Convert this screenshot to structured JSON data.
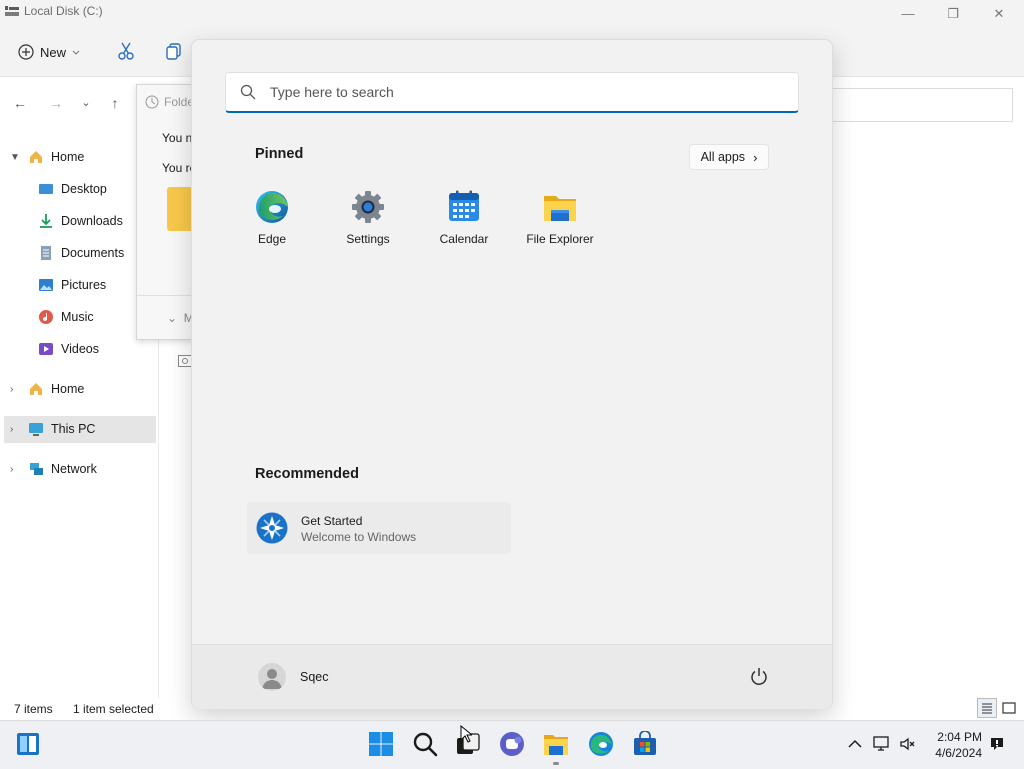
{
  "window": {
    "title": "Local Disk (C:)",
    "minimize_glyph": "—",
    "restore_glyph": "❐",
    "close_glyph": "✕"
  },
  "toolbar": {
    "new_label": "New"
  },
  "sidebar": {
    "items": [
      {
        "label": "Home",
        "icon": "home-icon"
      },
      {
        "label": "Desktop",
        "icon": "desktop-icon"
      },
      {
        "label": "Downloads",
        "icon": "downloads-icon"
      },
      {
        "label": "Documents",
        "icon": "documents-icon"
      },
      {
        "label": "Pictures",
        "icon": "pictures-icon"
      },
      {
        "label": "Music",
        "icon": "music-icon"
      },
      {
        "label": "Videos",
        "icon": "videos-icon"
      },
      {
        "label": "Home",
        "icon": "home-icon"
      },
      {
        "label": "This PC",
        "icon": "this-pc-icon"
      },
      {
        "label": "Network",
        "icon": "network-icon"
      }
    ]
  },
  "dialog": {
    "title": "Folde",
    "line1": "You n",
    "line2": "You re",
    "more": "M"
  },
  "status": {
    "items_count": "7 items",
    "selected": "1 item selected"
  },
  "start_menu": {
    "search_placeholder": "Type here to search",
    "pinned_title": "Pinned",
    "all_apps_label": "All apps",
    "pinned": [
      {
        "label": "Edge",
        "icon": "edge-icon"
      },
      {
        "label": "Settings",
        "icon": "settings-icon"
      },
      {
        "label": "Calendar",
        "icon": "calendar-icon"
      },
      {
        "label": "File Explorer",
        "icon": "file-explorer-icon"
      }
    ],
    "recommended_title": "Recommended",
    "recommended": [
      {
        "title": "Get Started",
        "subtitle": "Welcome to Windows",
        "icon": "get-started-icon"
      }
    ],
    "user_name": "Sqec"
  },
  "taskbar": {
    "apps": [
      "widgets-icon",
      "start-icon",
      "search-icon",
      "task-view-icon",
      "chat-icon",
      "file-explorer-icon",
      "edge-icon",
      "store-icon"
    ],
    "time": "2:04 PM",
    "date": "4/6/2024"
  },
  "colors": {
    "accent": "#0067c0",
    "start_bg": "#f2f2f2",
    "selection": "#e5e5e5"
  }
}
